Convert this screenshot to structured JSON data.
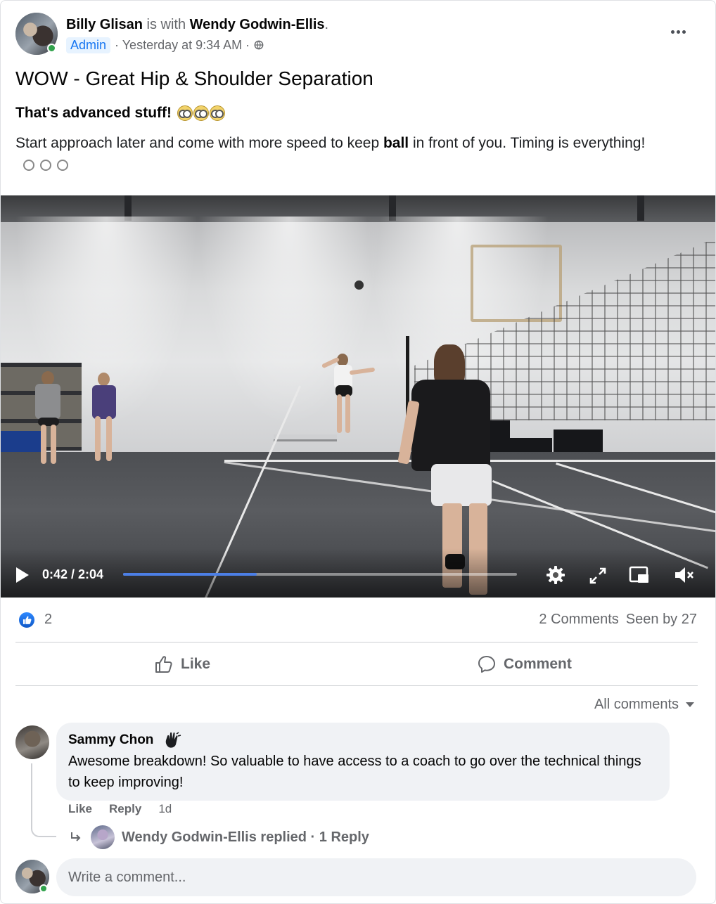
{
  "post": {
    "author": "Billy Glisan",
    "with_text": "is with",
    "tagged": "Wendy Godwin-Ellis",
    "period": ".",
    "badge": "Admin",
    "timestamp": "· Yesterday at 9:34 AM ·",
    "privacy_icon": "globe-icon",
    "title": "WOW - Great Hip & Shoulder Separation",
    "subtitle": "That's advanced stuff!",
    "body_part1": "Start approach later and come with more speed to keep",
    "body_bold": "ball",
    "body_part2": "in front of you. Timing is everything!"
  },
  "video": {
    "time": "0:42 / 2:04",
    "progress": 0.34
  },
  "stats": {
    "likes": "2",
    "comments": "2 Comments",
    "seen": "Seen by 27"
  },
  "actions": {
    "like": "Like",
    "comment": "Comment"
  },
  "comments": {
    "filter": "All comments",
    "items": [
      {
        "author": "Sammy Chon",
        "text": "Awesome breakdown! So valuable to have access to a coach to go over the technical things to keep improving!",
        "like": "Like",
        "reply": "Reply",
        "age": "1d"
      }
    ],
    "reply_summary": "Wendy Godwin-Ellis replied · 1 Reply",
    "write_placeholder": "Write a comment..."
  },
  "colors": {
    "accent": "#1877f2",
    "progress": "#4c7fe6",
    "online": "#31a24c"
  }
}
